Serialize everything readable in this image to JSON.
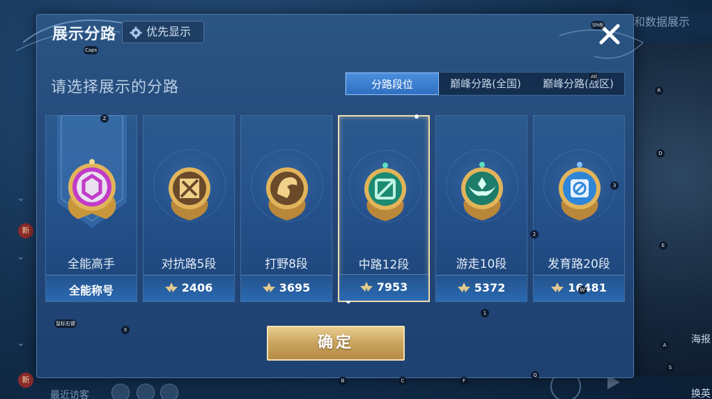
{
  "background": {
    "top_right_text": "战和数据展示",
    "new_badge": "新",
    "bottom_text": "最近访客",
    "right_labels": [
      "海报",
      "换英"
    ]
  },
  "dialog": {
    "title": "展示分路",
    "priority_label": "优先显示",
    "subtitle": "请选择展示的分路",
    "tabs": [
      {
        "label": "分路段位",
        "active": true
      },
      {
        "label": "巅峰分路(全国)",
        "active": false
      },
      {
        "label": "巅峰分路(战区)",
        "active": false
      }
    ],
    "cards": [
      {
        "name": "全能高手",
        "footer": "全能称号",
        "emblem": "allround-emblem",
        "color": "#c23bc8"
      },
      {
        "name": "对抗路5段",
        "score": "2406",
        "emblem": "clash-lane-emblem",
        "color": "#d7a13a"
      },
      {
        "name": "打野8段",
        "score": "3695",
        "emblem": "jungle-emblem",
        "color": "#d7a13a"
      },
      {
        "name": "中路12段",
        "score": "7953",
        "emblem": "mid-lane-emblem",
        "color": "#2fbf9a",
        "selected": true
      },
      {
        "name": "游走10段",
        "score": "5372",
        "emblem": "roam-emblem",
        "color": "#2fbf9a"
      },
      {
        "name": "发育路20段",
        "score": "16481",
        "emblem": "farm-lane-emblem",
        "color": "#3a8fe0"
      }
    ],
    "confirm_label": "确定"
  },
  "key_hints": {
    "shift": "Shift",
    "caps": "Caps",
    "alt": "Alt",
    "z": "Z",
    "r": "R",
    "d": "D",
    "three": "3",
    "two": "2",
    "e": "E",
    "one": "1",
    "x": "X",
    "mouse": "鼠标右键",
    "a": "A",
    "s": "S",
    "b": "B",
    "c": "C",
    "f": "F",
    "q": "Q",
    "w": "W"
  },
  "colors": {
    "accent_gold": "#e9cc8d",
    "tab_active": "#3f82d4",
    "panel": "#24497a"
  }
}
